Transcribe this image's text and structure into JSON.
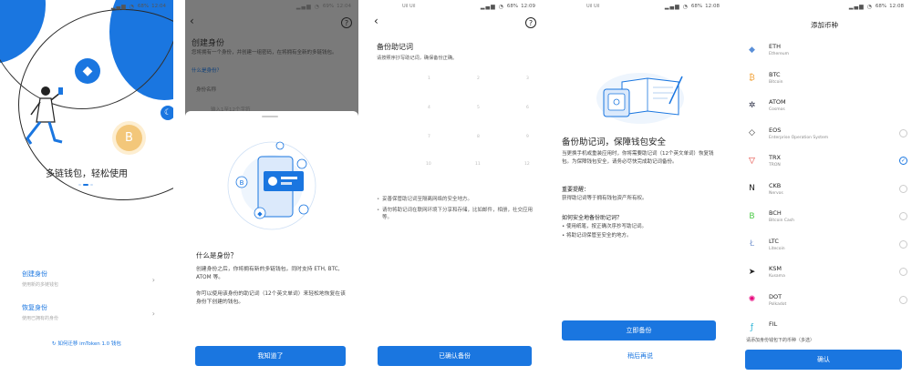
{
  "status": {
    "s1": {
      "carrier": "",
      "battery": "68%",
      "time": "12:04"
    },
    "s2": {
      "carrier": "",
      "battery": "69%",
      "time": "12:04"
    },
    "s3": {
      "carrier": "Uil Uil",
      "battery": "68%",
      "time": "12:09"
    },
    "s4": {
      "carrier": "Uil Uil",
      "battery": "68%",
      "time": "12:08"
    },
    "s5": {
      "carrier": "",
      "battery": "68%",
      "time": "12:08"
    }
  },
  "welcome": {
    "slogan": "多链钱包，轻松使用",
    "create": {
      "title": "创建身份",
      "desc": "使用新的多链钱包"
    },
    "restore": {
      "title": "恢复身份",
      "desc": "使用已拥有的身份"
    },
    "migrate": "如何迁移 imToken 1.0 钱包",
    "coin_btc": "B"
  },
  "create_identity": {
    "title": "创建身份",
    "desc": "您将拥有一个身份，并创建一组密码，在将拥有全新的多链钱包。",
    "what_link": "什么是身份？",
    "field_name": "身份名称",
    "field_hint": "输入1至12个字符",
    "sheet": {
      "question": "什么是身份？",
      "p1": "创建身份之后，你将拥有新的多链钱包，同时支持 ETH, BTC, ATOM 等。",
      "p2": "你可以使用该身份的助记词（12个英文单词）来轻松地恢复在该身份下创建的钱包。",
      "button": "我知道了"
    }
  },
  "backup_mnemonic": {
    "title": "备份助记词",
    "subtitle": "请按照序抄写助记词，确保备份正确。",
    "grid_numbers": [
      "1",
      "2",
      "3",
      "4",
      "5",
      "6",
      "7",
      "8",
      "9",
      "10",
      "11",
      "12"
    ],
    "tips": [
      "妥善保管助记词至隔离网络的安全地方。",
      "请勿将助记词在联网环境下分享和存储，比如邮件，相册，社交应用等。"
    ],
    "button": "已确认备份"
  },
  "backup_intro": {
    "title": "备份助记词，保障钱包安全",
    "desc": "当更换手机或重装应用时，你将需要助记词（12个英文单词）恢复钱包。为保障钱包安全，请务必尽快完成助记词备份。",
    "note_title": "重要提醒：",
    "note_text": "获得助记词等于拥有钱包资产所有权。",
    "how_title": "如何安全地备份助记词？",
    "how_items": [
      "• 使用纸笔，按正确次序抄写助记词。",
      "• 将助记词保管至安全的地方。"
    ],
    "button": "立即备份",
    "later": "稍后再说"
  },
  "add_coin": {
    "title": "添加币种",
    "coins": [
      {
        "symbol": "ETH",
        "name": "Ethereum",
        "glyph": "◆",
        "color": "#5a8fd8",
        "checked": false,
        "show_check": false
      },
      {
        "symbol": "BTC",
        "name": "Bitcoin",
        "glyph": "₿",
        "color": "#f2a33a",
        "checked": false,
        "show_check": false
      },
      {
        "symbol": "ATOM",
        "name": "Cosmos",
        "glyph": "✲",
        "color": "#2e3148",
        "checked": false,
        "show_check": false
      },
      {
        "symbol": "EOS",
        "name": "Enterprise Operation System",
        "glyph": "◇",
        "color": "#333333",
        "checked": false,
        "show_check": true
      },
      {
        "symbol": "TRX",
        "name": "TRON",
        "glyph": "▽",
        "color": "#e0322b",
        "checked": true,
        "show_check": true
      },
      {
        "symbol": "CKB",
        "name": "Nervos",
        "glyph": "N",
        "color": "#222222",
        "checked": false,
        "show_check": true
      },
      {
        "symbol": "BCH",
        "name": "Bitcoin Cash",
        "glyph": "B",
        "color": "#4cc947",
        "checked": false,
        "show_check": true
      },
      {
        "symbol": "LTC",
        "name": "Litecoin",
        "glyph": "Ł",
        "color": "#8aa5d6",
        "checked": false,
        "show_check": true
      },
      {
        "symbol": "KSM",
        "name": "Kusama",
        "glyph": "➤",
        "color": "#222222",
        "checked": false,
        "show_check": true
      },
      {
        "symbol": "DOT",
        "name": "Polkadot",
        "glyph": "✺",
        "color": "#e6007a",
        "checked": false,
        "show_check": true
      },
      {
        "symbol": "FIL",
        "name": "",
        "glyph": "ƒ",
        "color": "#2bb3d6",
        "checked": false,
        "show_check": false
      }
    ],
    "check_mark": "✓",
    "footer_note": "请添加身份钱包下的币种（多选）",
    "button": "确认"
  },
  "icons": {
    "back": "‹",
    "help": "?",
    "chevron": "›",
    "refresh": "↻",
    "eth": "◆",
    "moon": "☾",
    "signal": "▂▄▆ ◔"
  },
  "colors": {
    "accent": "#1a76e0",
    "btc": "#f3c77a"
  }
}
